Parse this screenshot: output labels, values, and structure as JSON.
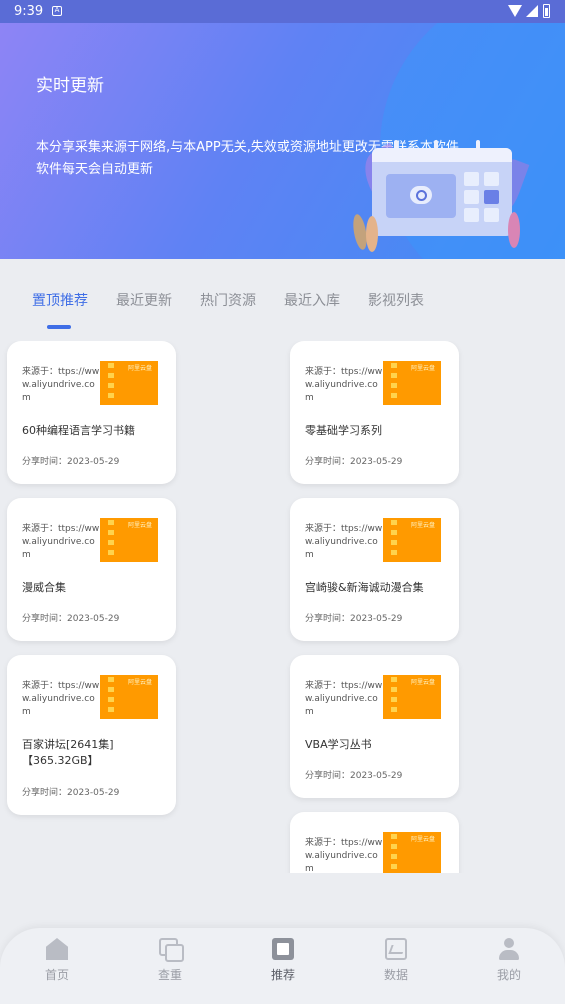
{
  "status_bar": {
    "time": "9:39",
    "notification": "A"
  },
  "banner": {
    "title": "实时更新",
    "description": "本分享采集来源于网络,与本APP无关,失效或资源地址更改无需联系本软件,软件每天会自动更新"
  },
  "tabs": [
    {
      "label": "置顶推荐",
      "active": true
    },
    {
      "label": "最近更新",
      "active": false
    },
    {
      "label": "热门资源",
      "active": false
    },
    {
      "label": "最近入库",
      "active": false
    },
    {
      "label": "影视列表",
      "active": false
    }
  ],
  "cards": [
    {
      "source": "来源于：ttps://www.aliyundrive.com",
      "thumb_label": "阿里云盘",
      "title": "60种编程语言学习书籍",
      "date": "分享时间：2023-05-29"
    },
    {
      "source": "来源于：ttps://www.aliyundrive.com",
      "thumb_label": "阿里云盘",
      "title": "零基础学习系列",
      "date": "分享时间：2023-05-29"
    },
    {
      "source": "来源于：ttps://www.aliyundrive.com",
      "thumb_label": "阿里云盘",
      "title": "漫威合集",
      "date": "分享时间：2023-05-29"
    },
    {
      "source": "来源于：ttps://www.aliyundrive.com",
      "thumb_label": "阿里云盘",
      "title": "宫崎骏&新海诚动漫合集",
      "date": "分享时间：2023-05-29"
    },
    {
      "source": "来源于：ttps://www.aliyundrive.com",
      "thumb_label": "阿里云盘",
      "title": "百家讲坛[2641集]【365.32GB】",
      "date": "分享时间：2023-05-29"
    },
    {
      "source": "来源于：ttps://www.aliyundrive.com",
      "thumb_label": "阿里云盘",
      "title": "VBA学习丛书",
      "date": "分享时间：2023-05-29"
    },
    {
      "source": "来源于：ttps://www.aliyundrive.com",
      "thumb_label": "阿里云盘",
      "title": "",
      "date": ""
    }
  ],
  "bottom_nav": [
    {
      "label": "首页",
      "icon": "home-icon"
    },
    {
      "label": "查重",
      "icon": "duplicate-icon"
    },
    {
      "label": "推荐",
      "icon": "recommend-icon",
      "active": true
    },
    {
      "label": "数据",
      "icon": "data-chart-icon"
    },
    {
      "label": "我的",
      "icon": "profile-icon"
    }
  ],
  "colors": {
    "accent": "#3f6ee6",
    "thumb": "#ff9a00",
    "banner_start": "#8e84f5",
    "banner_end": "#3d8cf5"
  }
}
